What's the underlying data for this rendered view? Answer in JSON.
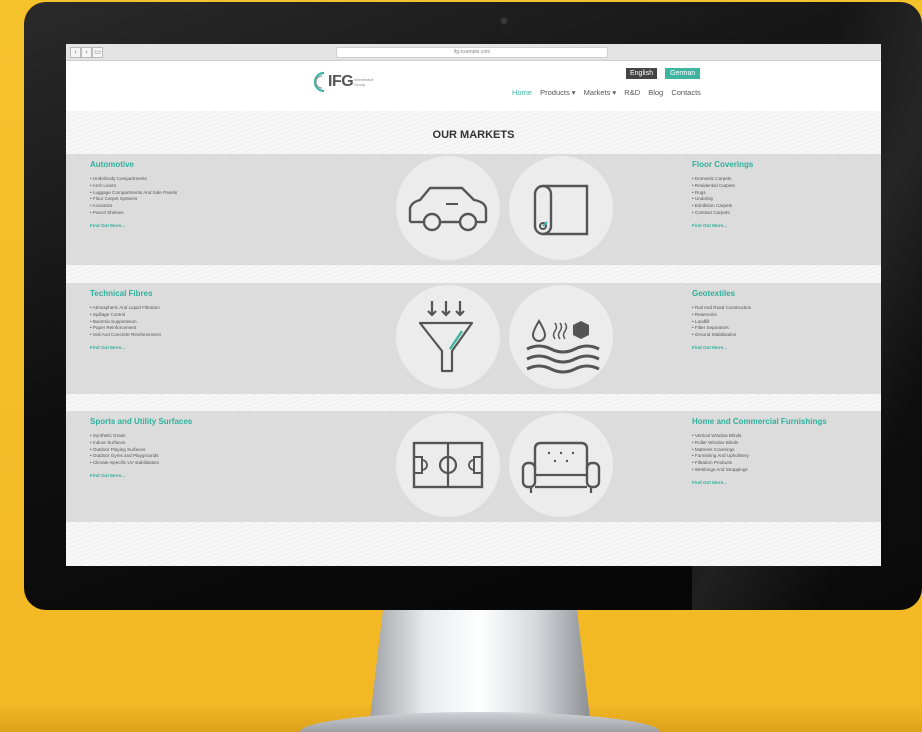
{
  "browser": {
    "url": "ifg.example.com"
  },
  "header": {
    "logo_text": "IFG",
    "logo_sub": "Interweave Group",
    "lang_english": "English",
    "lang_german": "German",
    "nav": [
      "Home",
      "Products ▾",
      "Markets ▾",
      "R&D",
      "Blog",
      "Contacts"
    ]
  },
  "page": {
    "title": "OUR MARKETS"
  },
  "markets": [
    {
      "name": "Automotive",
      "items": [
        "Underbody Compartments",
        "Arch Liners",
        "Luggage Compartments And Side Panels",
        "Floor Carpet Systems",
        "Acoustics",
        "Parcel Shelves"
      ],
      "link": "Find Out More..."
    },
    {
      "name": "Floor Coverings",
      "items": [
        "Domestic Carpets",
        "Residential Carpets",
        "Rugs",
        "Underlay",
        "Exhibition Carpets",
        "Contract Carpets"
      ],
      "link": "Find Out More..."
    },
    {
      "name": "Technical Fibres",
      "items": [
        "Atmospheric And Liquid Filtration",
        "Spillage Control",
        "Bacteria Suppression",
        "Paper Reinforcement",
        "Soil And Concrete Reinforcement"
      ],
      "link": "Find Out More..."
    },
    {
      "name": "Geotextiles",
      "items": [
        "Rail And Road Construction",
        "Reservoirs",
        "Landfill",
        "Filter Separators",
        "Ground Stabilisation"
      ],
      "link": "Find Out More..."
    },
    {
      "name": "Sports and Utility Surfaces",
      "items": [
        "Synthetic Grass",
        "Indoor Surfaces",
        "Outdoor Playing Surfaces",
        "Outdoor Gyms and Playgrounds",
        "Climate-Specific UV stabilisation"
      ],
      "link": "Find Out More..."
    },
    {
      "name": "Home and Commercial Furnishings",
      "items": [
        "Vertical Window Blinds",
        "Roller Window Blinds",
        "Mattress Coverings",
        "Furnishing And Upholstery",
        "Filtration Products",
        "Webbings And Strappings"
      ],
      "link": "Find Out More..."
    }
  ],
  "icons": [
    "car-icon",
    "carpet-roll-icon",
    "filter-funnel-icon",
    "geotextile-layers-icon",
    "football-pitch-icon",
    "sofa-icon"
  ],
  "colors": {
    "accent": "#3db5a2",
    "background": "#f4bd28"
  }
}
